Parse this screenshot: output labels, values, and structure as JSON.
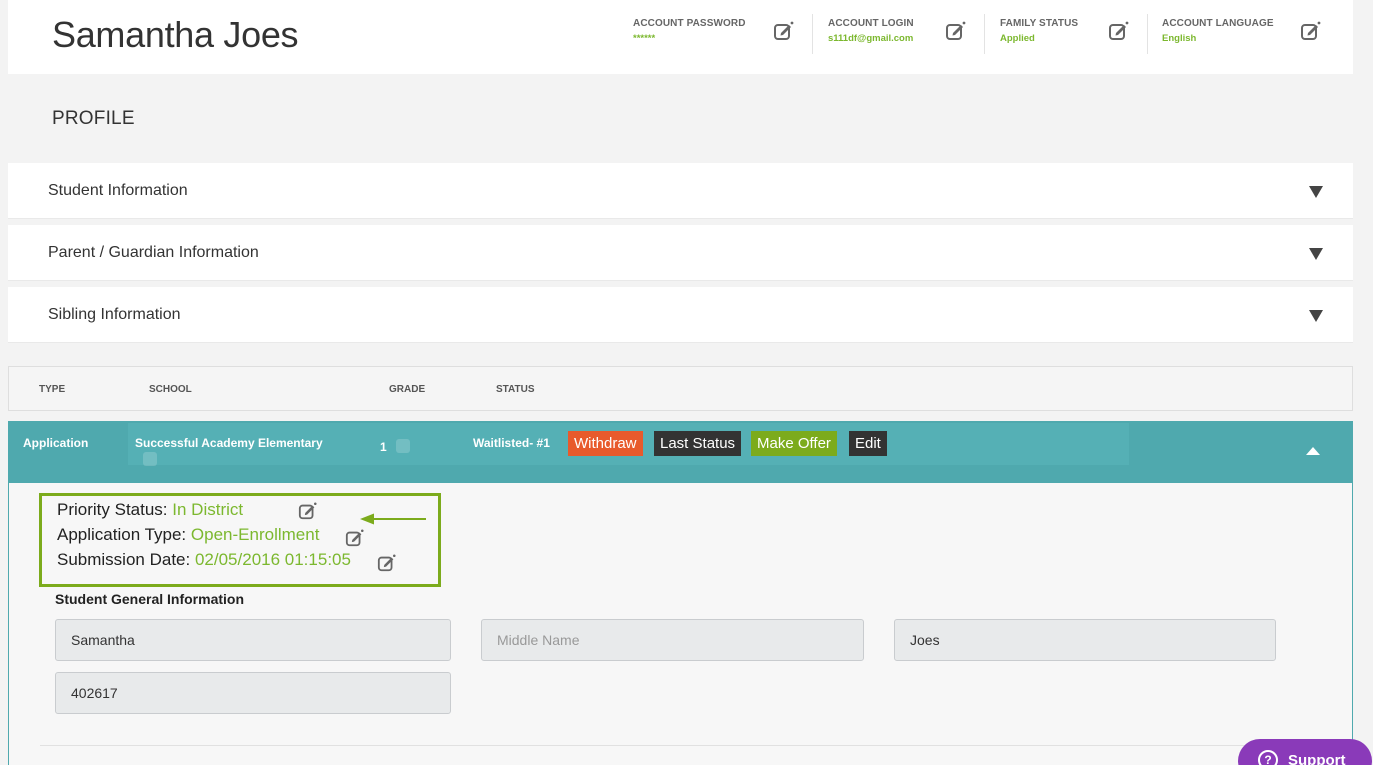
{
  "header": {
    "user_name": "Samantha Joes",
    "account_password_label": "ACCOUNT PASSWORD",
    "account_password_value": "******",
    "account_login_label": "ACCOUNT LOGIN",
    "account_login_value": "s111df@gmail.com",
    "family_status_label": "FAMILY STATUS",
    "family_status_value": "Applied",
    "account_language_label": "ACCOUNT LANGUAGE",
    "account_language_value": "English"
  },
  "profile": {
    "title": "PROFILE",
    "sections": [
      {
        "label": "Student Information"
      },
      {
        "label": "Parent / Guardian Information"
      },
      {
        "label": "Sibling Information"
      }
    ]
  },
  "table": {
    "headers": [
      "TYPE",
      "SCHOOL",
      "GRADE",
      "STATUS"
    ],
    "row": {
      "type": "Application",
      "school": "Successful Academy Elementary",
      "grade": "1",
      "status": "Waitlisted- #1",
      "buttons": {
        "withdraw": "Withdraw",
        "last_status": "Last Status",
        "make_offer": "Make Offer",
        "edit": "Edit"
      }
    }
  },
  "details": {
    "priority_label": "Priority Status:",
    "priority_value": "In District",
    "app_type_label": "Application Type:",
    "app_type_value": "Open-Enrollment",
    "submission_label": "Submission Date:",
    "submission_value": "02/05/2016 01:15:05"
  },
  "student_general": {
    "title": "Student General Information",
    "first_name": "Samantha",
    "middle_name_placeholder": "Middle Name",
    "last_name": "Joes",
    "student_id": "402617"
  },
  "support": {
    "label": "Support",
    "glyph": "?"
  },
  "colors": {
    "accent_green": "#7cb82f",
    "teal": "#4fa9ae",
    "withdraw": "#e85a2c",
    "make_offer": "#7cab1c",
    "support": "#8a3ab9"
  }
}
